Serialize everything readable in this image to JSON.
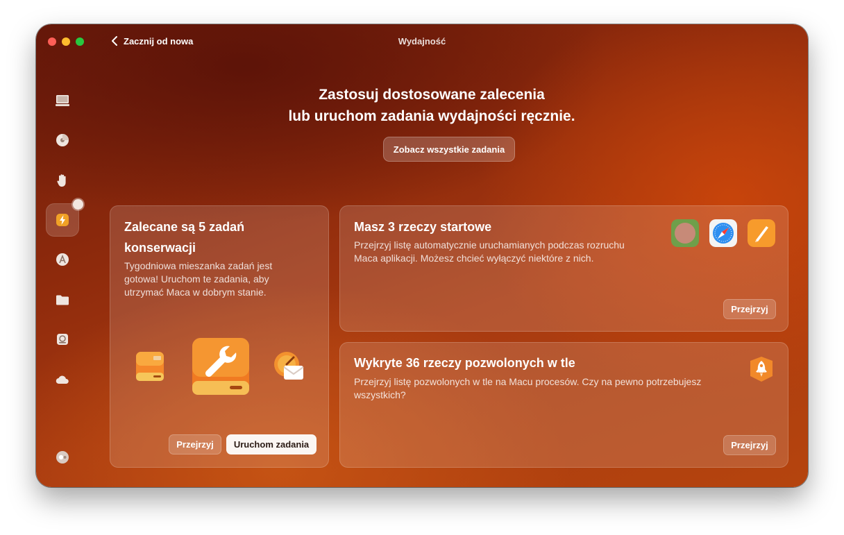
{
  "window": {
    "title": "Wydajność"
  },
  "nav": {
    "back_label": "Zacznij od nowa"
  },
  "sidebar": {
    "items": [
      {
        "name": "smart-care",
        "icon": "monitor-icon"
      },
      {
        "name": "cleanup",
        "icon": "disc-icon"
      },
      {
        "name": "protection",
        "icon": "hand-icon"
      },
      {
        "name": "performance",
        "icon": "lightning-icon",
        "active": true
      },
      {
        "name": "applications",
        "icon": "apps-icon"
      },
      {
        "name": "my-clutter",
        "icon": "folder-icon"
      },
      {
        "name": "space-lens",
        "icon": "drive-icon"
      },
      {
        "name": "cloud",
        "icon": "cloud-icon"
      },
      {
        "name": "assistant",
        "icon": "assistant-icon"
      }
    ]
  },
  "header": {
    "line1": "Zastosuj dostosowane zalecenia",
    "line2": "lub uruchom zadania wydajności ręcznie.",
    "view_all": "Zobacz wszystkie zadania"
  },
  "maintenance": {
    "title_line1": "Zalecane są 5 zadań",
    "title_line2": "konserwacji",
    "desc_line1": "Tygodniowa mieszanka zadań jest",
    "desc_line2": "gotowa! Uruchom te zadania, aby",
    "desc_line3": "utrzymać Maca w dobrym stanie.",
    "review": "Przejrzyj",
    "run": "Uruchom zadania"
  },
  "startup": {
    "title": "Masz 3 rzeczy startowe",
    "desc_line1": "Przejrzyj listę automatycznie uruchamianych podczas rozruchu",
    "desc_line2": "Maca aplikacji. Możesz chcieć wyłączyć niektóre z nich.",
    "review": "Przejrzyj"
  },
  "background": {
    "title": "Wykryte 36 rzeczy pozwolonych w tle",
    "desc_line1": "Przejrzyj listę pozwolonych w tle na Macu procesów. Czy na pewno potrzebujesz",
    "desc_line2": "wszystkich?",
    "review": "Przejrzyj"
  },
  "colors": {
    "accent_orange": "#f28a1e",
    "window_dark": "#6b1b0a",
    "window_bright": "#c04a0e"
  }
}
